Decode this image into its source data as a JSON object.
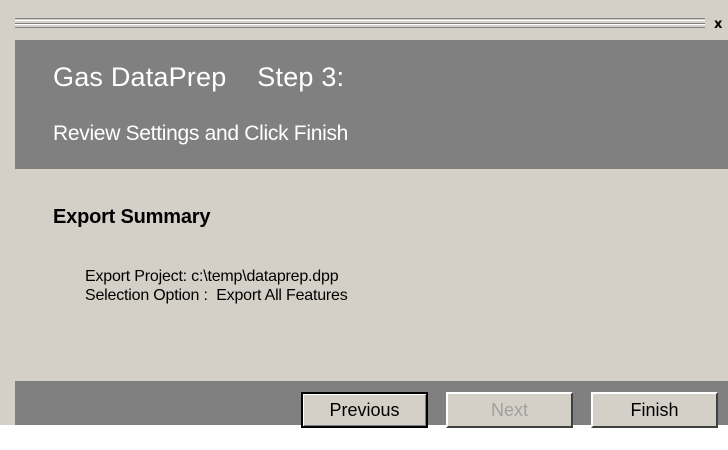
{
  "titlebar": {
    "close_glyph": "x"
  },
  "header": {
    "title": "Gas DataPrep    Step 3:",
    "subtitle": "Review Settings and Click Finish"
  },
  "summary": {
    "heading": "Export Summary",
    "lines": [
      "Export Project: c:\\temp\\dataprep.dpp",
      "Selection Option :  Export All Features"
    ]
  },
  "footer": {
    "previous_label": "Previous",
    "next_label": "Next",
    "finish_label": "Finish"
  },
  "colors": {
    "panel_gray": "#808080",
    "window_face": "#d4d0c8",
    "header_text": "#ffffff",
    "disabled_text": "#a0a0a0"
  }
}
